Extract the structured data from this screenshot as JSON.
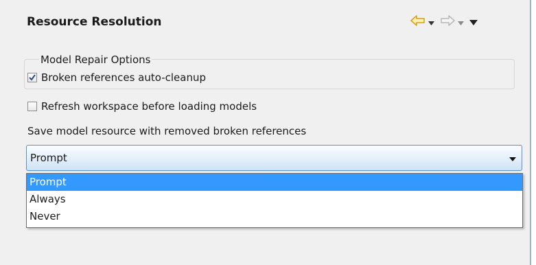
{
  "view": {
    "title": "Resource Resolution"
  },
  "toolbar": {
    "back_icon": "back-arrow-icon",
    "forward_icon": "forward-arrow-icon",
    "menu_icon": "view-menu-icon",
    "accent_color": "#e8b30a"
  },
  "repair_group": {
    "legend": "Model Repair Options",
    "auto_cleanup": {
      "label": "Broken references auto-cleanup",
      "checked": true
    }
  },
  "refresh_option": {
    "label": "Refresh workspace before loading models",
    "checked": false
  },
  "save_option": {
    "label": "Save model resource with removed broken references",
    "selected": "Prompt",
    "options": [
      "Prompt",
      "Always",
      "Never"
    ],
    "highlight_color": "#3399ff"
  }
}
